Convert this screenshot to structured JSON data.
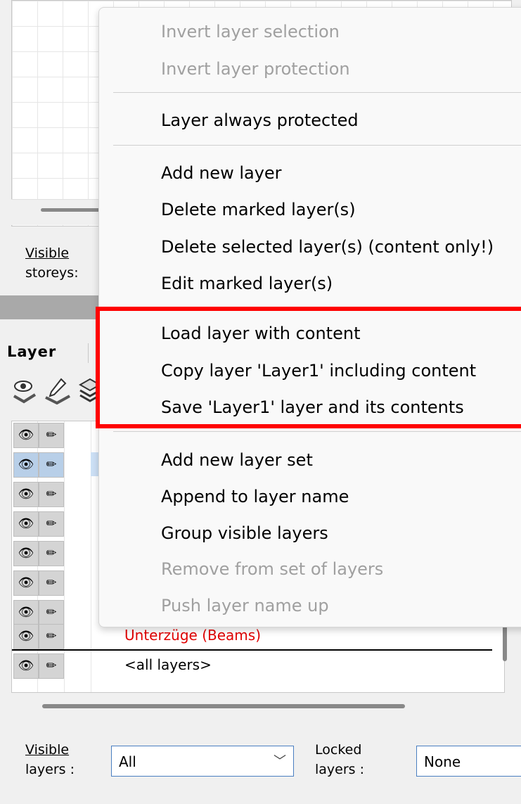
{
  "storey_panel": {
    "visible_storeys_label_line1": "Visible",
    "visible_storeys_label_line2": "storeys:"
  },
  "layer_panel": {
    "tab_label": "Layer",
    "rows": [
      {
        "name": ""
      },
      {
        "name": ""
      },
      {
        "name": ""
      },
      {
        "name": ""
      },
      {
        "name": ""
      },
      {
        "name": ""
      },
      {
        "name": ""
      },
      {
        "name": "Unterzüge (Beams)"
      },
      {
        "name": "<all layers>"
      }
    ],
    "eye_glyph": "👁",
    "pencil_glyph": "✏",
    "visible_layers_label_line1": "Visible",
    "visible_layers_label_line2": "layers :",
    "visible_layers_value": "All",
    "locked_layers_label_line1": "Locked",
    "locked_layers_label_line2": "layers :",
    "locked_layers_value": "None",
    "dropdown_arrow": "﹀"
  },
  "colors": {
    "highlight": "#ff0000",
    "beams_text": "#e00000",
    "selected_row": "#cce0f5"
  },
  "context_menu": {
    "items": {
      "invert_selection": "Invert layer selection",
      "invert_protection": "Invert layer protection",
      "always_protected": "Layer always protected",
      "add_new_layer": "Add new layer",
      "delete_marked": "Delete marked layer(s)",
      "delete_selected": "Delete selected layer(s) (content only!)",
      "edit_marked": "Edit marked layer(s)",
      "load_layer": "Load layer with content",
      "copy_layer": "Copy layer 'Layer1' including content",
      "save_layer": "Save 'Layer1'  layer and its contents",
      "add_layer_set": "Add new layer set",
      "append_name": "Append to layer name",
      "group_visible": "Group visible layers",
      "remove_from_set": "Remove from set of layers",
      "push_name_up": "Push layer name up"
    }
  }
}
